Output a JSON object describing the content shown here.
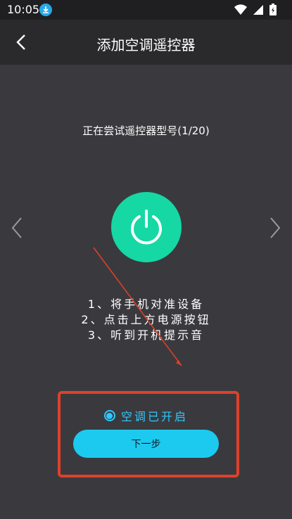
{
  "status_bar": {
    "time": "10:05",
    "icons": [
      "download-icon",
      "wifi-icon",
      "signal-icon",
      "battery-icon"
    ]
  },
  "header": {
    "title": "添加空调遥控器",
    "back_icon": "chevron-left-icon"
  },
  "main": {
    "trying_text": "正在尝试遥控器型号(1/20)",
    "prev_icon": "chevron-left-icon",
    "next_icon": "chevron-right-icon",
    "power_icon": "power-icon",
    "instructions": [
      "1、将手机对准设备",
      "2、点击上方电源按钮",
      "3、听到开机提示音"
    ],
    "ac_on_label": "空调已开启",
    "ac_on_checked": true,
    "next_button_label": "下一步"
  },
  "colors": {
    "background": "#3a3a3e",
    "appbar": "#2a2a2d",
    "power_button": "#16d8a4",
    "accent": "#1ccaf0",
    "annotation": "#e0402a"
  }
}
